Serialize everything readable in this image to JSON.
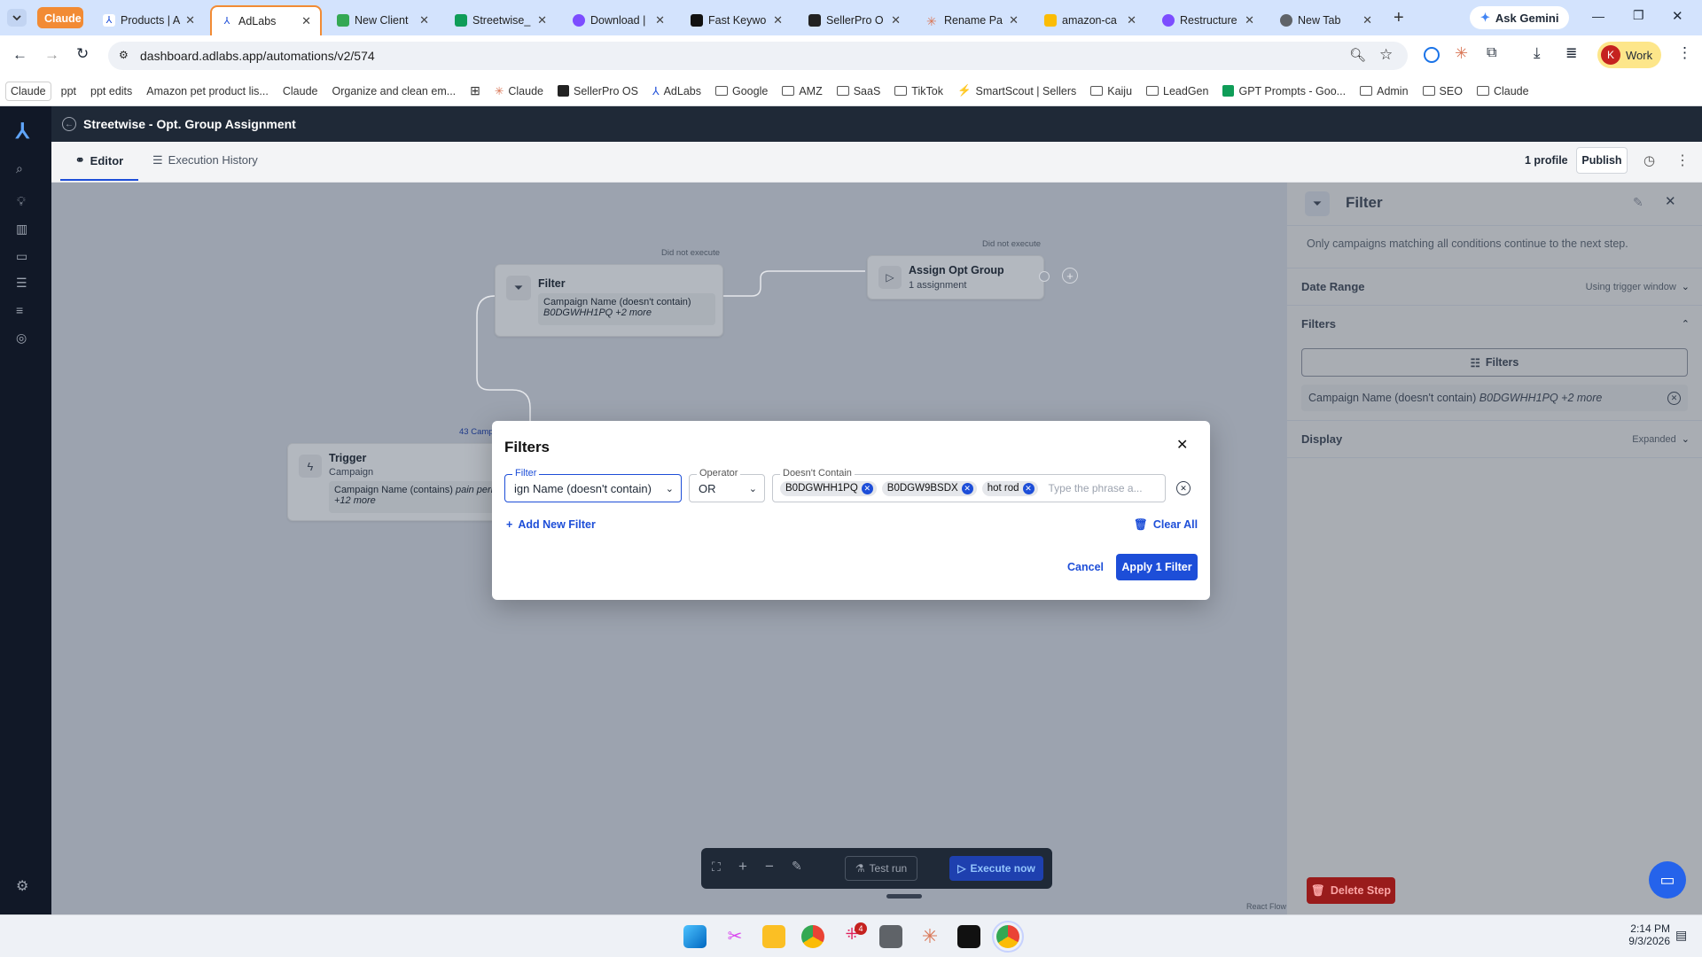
{
  "browser": {
    "tabs": [
      {
        "label": "Claude",
        "group": true
      },
      {
        "label": "Products | A"
      },
      {
        "label": "AdLabs",
        "active": true
      },
      {
        "label": "New Client"
      },
      {
        "label": "Streetwise_"
      },
      {
        "label": "Download |"
      },
      {
        "label": "Fast Keywo"
      },
      {
        "label": "SellerPro O"
      },
      {
        "label": "Rename Pa"
      },
      {
        "label": "amazon-ca"
      },
      {
        "label": "Restructure"
      },
      {
        "label": "New Tab"
      }
    ],
    "ask_gemini": "Ask Gemini",
    "url": "dashboard.adlabs.app/automations/v2/574",
    "profile": {
      "initial": "K",
      "name": "Work"
    },
    "bookmarks": [
      "Claude",
      "ppt",
      "ppt edits",
      "Amazon pet product lis...",
      "Claude",
      "Organize and clean em...",
      "Claude",
      "SellerPro OS",
      "AdLabs",
      "Google",
      "AMZ",
      "SaaS",
      "TikTok",
      "SmartScout | Sellers",
      "Kaiju",
      "LeadGen",
      "GPT Prompts - Goo...",
      "Admin",
      "SEO",
      "Claude"
    ]
  },
  "app": {
    "title": "Streetwise - Opt. Group Assignment",
    "tabs": {
      "editor": "Editor",
      "history": "Execution History"
    },
    "profile_count": "1 profile",
    "publish": "Publish"
  },
  "canvas": {
    "filter_node": {
      "title": "Filter",
      "status": "Did not execute",
      "condition": "Campaign Name (doesn't contain)",
      "values": "B0DGWHH1PQ +2 more"
    },
    "assign_node": {
      "title": "Assign Opt Group",
      "sub": "1 assignment",
      "status": "Did not execute"
    },
    "trigger_node": {
      "title": "Trigger",
      "sub": "Campaign",
      "condition": "Campaign Name (contains)",
      "values_italic": "pain peri",
      "more": "+12 more",
      "edge_label": "43 Camp"
    },
    "toolbar": {
      "test_run": "Test run",
      "execute_now": "Execute now"
    },
    "react_flow": "React Flow"
  },
  "right_panel": {
    "title": "Filter",
    "description": "Only campaigns matching all conditions continue to the next step.",
    "date_range": {
      "label": "Date Range",
      "value": "Using trigger window"
    },
    "filters": {
      "label": "Filters",
      "button": "Filters",
      "item_condition": "Campaign Name (doesn't contain)",
      "item_values": "B0DGWHH1PQ +2 more"
    },
    "display": {
      "label": "Display",
      "value": "Expanded"
    },
    "delete": "Delete Step"
  },
  "modal": {
    "title": "Filters",
    "filter_label": "Filter",
    "filter_value": "ign Name (doesn't contain)",
    "operator_label": "Operator",
    "operator_value": "OR",
    "contains_label": "Doesn't Contain",
    "chips": [
      "B0DGWHH1PQ",
      "B0DGW9BSDX",
      "hot rod"
    ],
    "placeholder": "Type the phrase a...",
    "add_filter": "Add New Filter",
    "clear_all": "Clear All",
    "cancel": "Cancel",
    "apply": "Apply 1 Filter"
  },
  "taskbar": {
    "time": "2:14 PM",
    "date": "9/3/2026",
    "badge": "4"
  }
}
